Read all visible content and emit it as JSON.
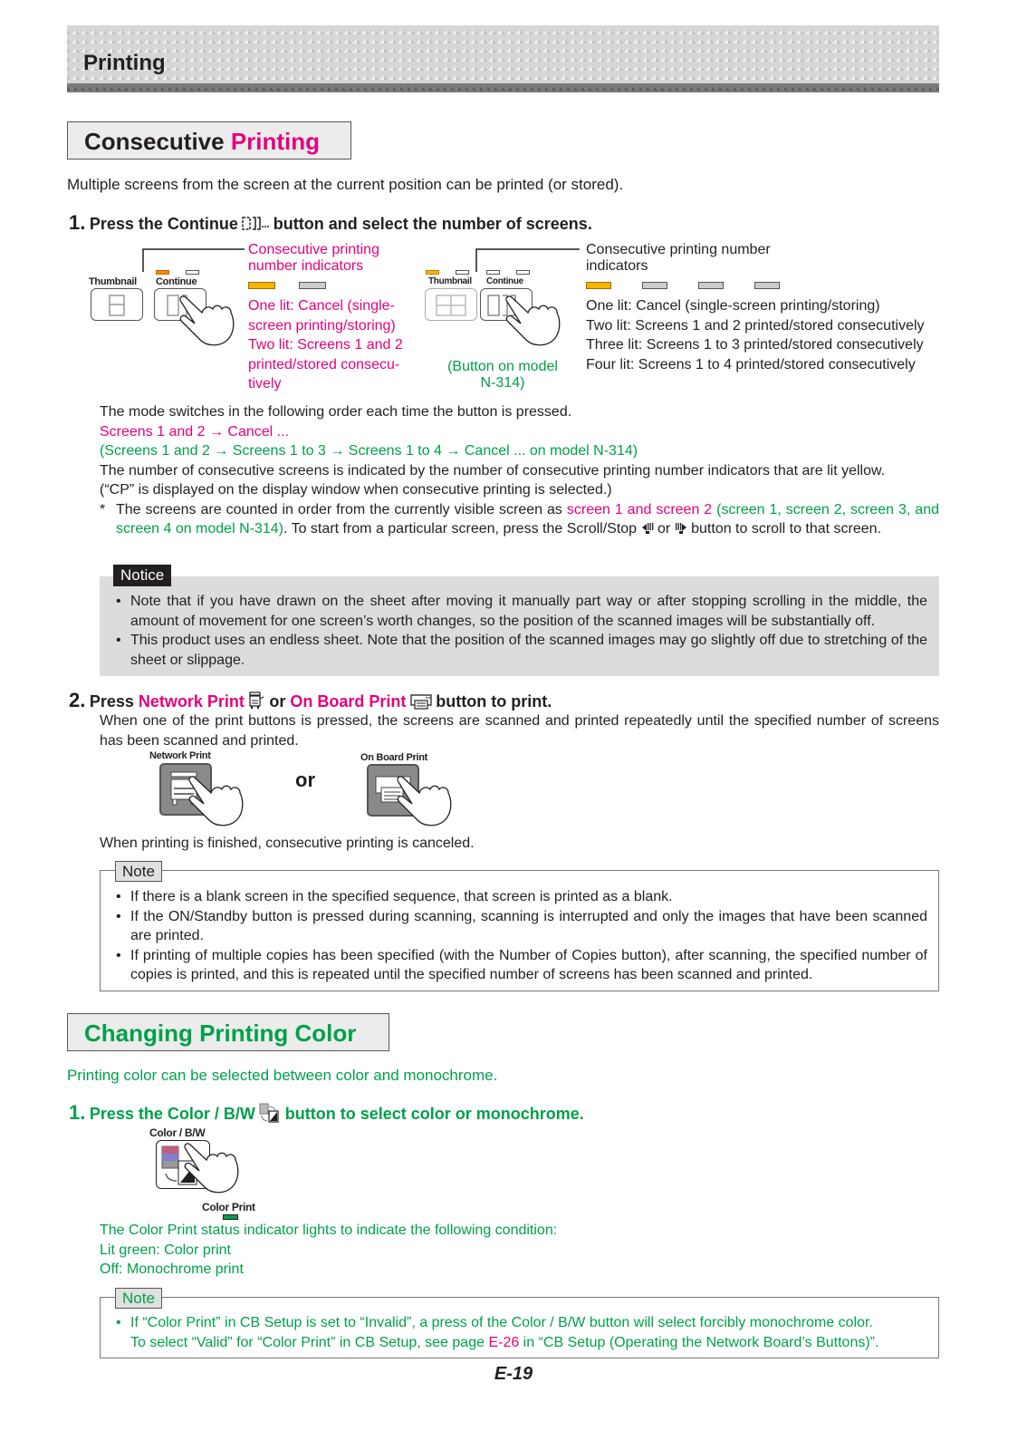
{
  "header": {
    "title": "Printing"
  },
  "consecutive": {
    "title_part1": "Consecutive ",
    "title_part2": "Printing",
    "intro": "Multiple screens from the screen at the current position can be printed (or stored).",
    "step1": {
      "num": "1.",
      "text_before": "Press the Continue",
      "text_after": "button and select the number of screens."
    },
    "diagram_left": {
      "thumbnail_label": "Thumbnail",
      "continue_label": "Continue",
      "indicator_title": "Consecutive printing number indicators",
      "indicator_states": [
        "lit",
        "off"
      ],
      "lines": [
        "One lit: Cancel (single-",
        "screen printing/storing)",
        "Two lit: Screens 1 and 2",
        "printed/stored consecu-",
        "tively"
      ]
    },
    "diagram_right": {
      "thumbnail_label": "Thumbnail",
      "continue_label": "Continue",
      "model_caption_1": "(Button on model",
      "model_caption_2": "N-314)",
      "indicator_title_1": "Consecutive printing number",
      "indicator_title_2": "indicators",
      "indicator_states": [
        "lit",
        "off",
        "off",
        "off"
      ],
      "lines": [
        "One lit: Cancel (single-screen printing/storing)",
        "Two lit: Screens 1 and 2 printed/stored consecutively",
        "Three lit: Screens 1 to 3 printed/stored consecutively",
        "Four lit: Screens 1 to 4 printed/stored consecutively"
      ]
    },
    "mode_text": "The mode switches in the following order each time the button is pressed.",
    "mode_seq_pink": "Screens 1 and 2 → Cancel ...",
    "mode_seq_green": "(Screens 1 and 2 → Screens 1 to 3 → Screens 1 to 4 → Cancel ... on model N-314)",
    "count_text_1": "The number of consecutive screens is indicated by the number of consecutive printing number indicators that are lit yellow.",
    "count_text_2": "(“CP” is displayed on the display window when consecutive printing is selected.)",
    "footnote": {
      "mark": "*",
      "part1": "The screens are counted in order from the currently visible screen as ",
      "part2_pink": "screen 1 and screen 2",
      "part3_green": " (screen 1, screen 2, screen 3, and screen 4 on model N-314)",
      "part4": ". To start from a particular screen, press the Scroll/Stop",
      "or": "or",
      "part5": "button to scroll to that screen."
    },
    "notice": {
      "tag": "Notice",
      "items": [
        "Note that if you have drawn on the sheet after moving it manually part way or after stopping scrolling in the middle, the amount of movement for one screen’s worth changes, so the position of the scanned images will be substantially off.",
        "This product uses an endless sheet. Note that the position of the scanned images may go slightly off due to stretching of the sheet or slippage."
      ]
    },
    "step2": {
      "num": "2.",
      "press": "Press ",
      "network_print": "Network Print",
      "or": " or ",
      "onboard_print": "On Board Print",
      "tail": "button to print.",
      "desc": "When one of the print buttons is pressed, the screens are scanned and printed repeatedly until the specified number of screens has been scanned and printed.",
      "network_label": "Network Print",
      "onboard_label": "On Board Print",
      "or_big": "or",
      "finished": "When printing is finished, consecutive printing is canceled."
    },
    "note": {
      "tag": "Note",
      "items": [
        "If there is a blank screen in the specified sequence, that screen is printed as a blank.",
        "If the ON/Standby button is pressed during scanning, scanning is interrupted and only the images that have been scanned are printed.",
        "If printing of multiple copies has been specified (with the Number of Copies button), after scanning, the specified number of copies is printed, and this is repeated until the specified number of screens has been scanned and printed."
      ]
    }
  },
  "color": {
    "title": "Changing Printing Color",
    "intro": "Printing color can be selected between color and monochrome.",
    "step1": {
      "num": "1.",
      "text_before": "Press the Color / B/W",
      "text_after": "button to select color or monochrome."
    },
    "button_label": "Color / B/W",
    "indicator_label": "Color Print",
    "status_lines": [
      "The Color Print status indicator lights to indicate the following condition:",
      "Lit green: Color print",
      "Off: Monochrome print"
    ],
    "note": {
      "tag": "Note",
      "line1": "If “Color Print” in CB Setup is set to “Invalid”, a press of the Color / B/W button will select forcibly monochrome color.",
      "line2_before": "To select “Valid” for “Color Print” in CB Setup, see page ",
      "link": "E-26",
      "line2_after": " in “CB Setup (Operating the Network Board’s Buttons)”."
    }
  },
  "footer": {
    "page": "E-19"
  },
  "colors": {
    "accent_pink": "#e5007e",
    "accent_green": "#00a04a",
    "led_yellow": "#f4b400"
  }
}
